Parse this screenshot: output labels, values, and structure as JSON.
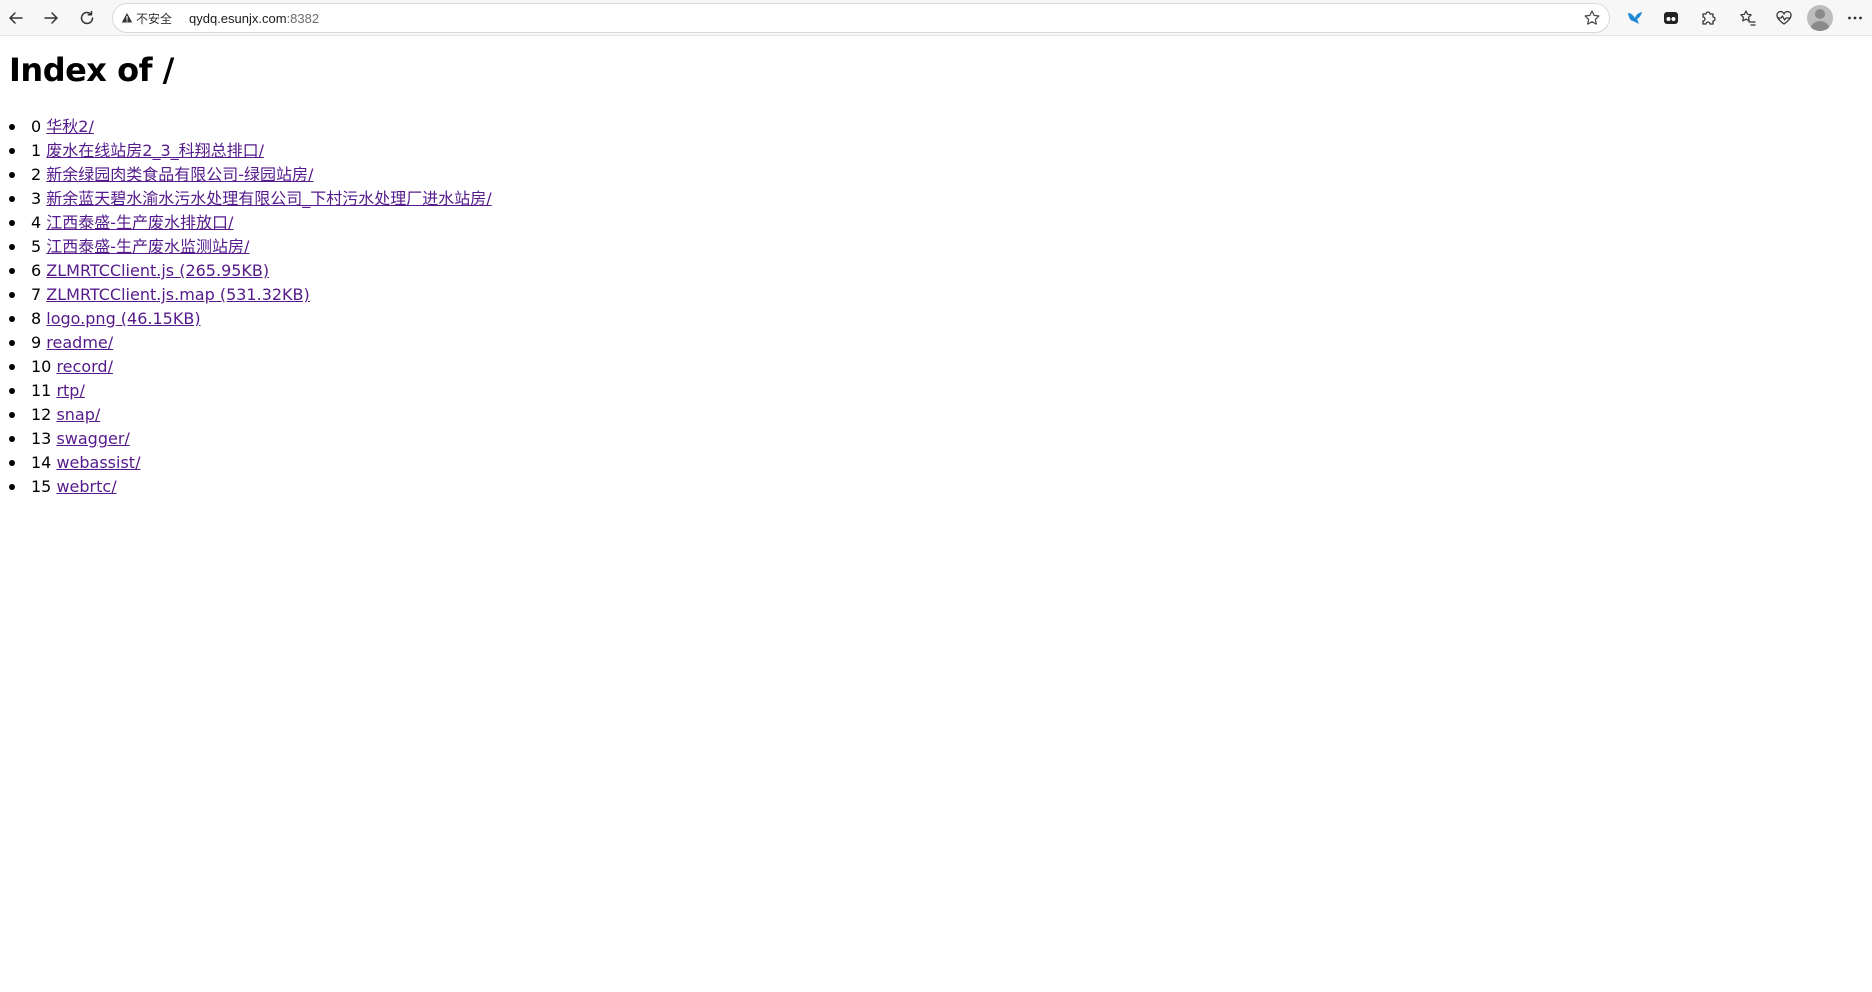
{
  "browser": {
    "security_label": "不安全",
    "url_host": "qydq.esunjx.com",
    "url_port": ":8382"
  },
  "page": {
    "title": "Index of /",
    "entries": [
      {
        "index": "0",
        "name": "华秋2/"
      },
      {
        "index": "1",
        "name": "废水在线站房2_3_科翔总排口/"
      },
      {
        "index": "2",
        "name": "新余绿园肉类食品有限公司-绿园站房/"
      },
      {
        "index": "3",
        "name": "新余蓝天碧水渝水污水处理有限公司_下村污水处理厂进水站房/"
      },
      {
        "index": "4",
        "name": "江西泰盛-生产废水排放口/"
      },
      {
        "index": "5",
        "name": "江西泰盛-生产废水监测站房/"
      },
      {
        "index": "6",
        "name": "ZLMRTCClient.js (265.95KB)"
      },
      {
        "index": "7",
        "name": "ZLMRTCClient.js.map (531.32KB)"
      },
      {
        "index": "8",
        "name": "logo.png (46.15KB)"
      },
      {
        "index": "9",
        "name": "readme/"
      },
      {
        "index": "10",
        "name": "record/"
      },
      {
        "index": "11",
        "name": "rtp/"
      },
      {
        "index": "12",
        "name": "snap/"
      },
      {
        "index": "13",
        "name": "swagger/"
      },
      {
        "index": "14",
        "name": "webassist/"
      },
      {
        "index": "15",
        "name": "webrtc/"
      }
    ]
  },
  "colors": {
    "link_visited": "#551a8b",
    "toolbar_bg": "#f7f7f7"
  }
}
